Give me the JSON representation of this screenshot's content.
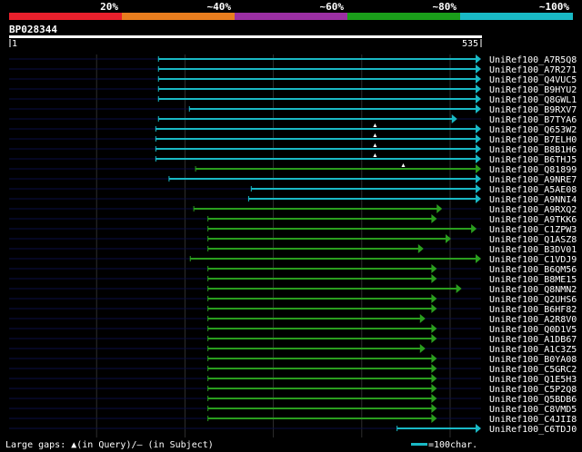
{
  "identity_legend": {
    "labels": [
      "20%",
      "~40%",
      "~60%",
      "~80%",
      "~100%"
    ],
    "colors": [
      "#e8202c",
      "#e87d1e",
      "#9b2fa3",
      "#1a9e1a",
      "#19b9c5"
    ]
  },
  "query": {
    "id": "BP028344",
    "start_label": "1",
    "end_label": "535",
    "length": 535
  },
  "colors": {
    "background": "#000000",
    "high_identity": "#19b9c5",
    "mid_identity": "#2a9e1e",
    "lane": "#0a0e44",
    "grid": "#2e2e2e",
    "text": "#ffffff"
  },
  "hits": [
    {
      "id": "UniRef100_A7R5Q8",
      "start": 170,
      "end": 535,
      "color": "cyan",
      "gap": null
    },
    {
      "id": "UniRef100_A7R271",
      "start": 170,
      "end": 535,
      "color": "cyan",
      "gap": null
    },
    {
      "id": "UniRef100_Q4VUC5",
      "start": 170,
      "end": 535,
      "color": "cyan",
      "gap": null
    },
    {
      "id": "UniRef100_B9HYU2",
      "start": 170,
      "end": 535,
      "color": "cyan",
      "gap": null
    },
    {
      "id": "UniRef100_Q8GWL1",
      "start": 170,
      "end": 535,
      "color": "cyan",
      "gap": null
    },
    {
      "id": "UniRef100_B9RXV7",
      "start": 205,
      "end": 535,
      "color": "cyan",
      "gap": null
    },
    {
      "id": "UniRef100_B7TYA6",
      "start": 170,
      "end": 508,
      "color": "cyan",
      "gap": null
    },
    {
      "id": "UniRef100_Q653W2",
      "start": 167,
      "end": 535,
      "color": "cyan",
      "gap": 415
    },
    {
      "id": "UniRef100_B7ELH0",
      "start": 167,
      "end": 535,
      "color": "cyan",
      "gap": 415
    },
    {
      "id": "UniRef100_B8B1H6",
      "start": 167,
      "end": 535,
      "color": "cyan",
      "gap": 415
    },
    {
      "id": "UniRef100_B6THJ5",
      "start": 167,
      "end": 535,
      "color": "cyan",
      "gap": 415
    },
    {
      "id": "UniRef100_Q81899",
      "start": 212,
      "end": 535,
      "color": "green",
      "gap": 447
    },
    {
      "id": "UniRef100_A9NRE7",
      "start": 182,
      "end": 535,
      "color": "cyan",
      "gap": null
    },
    {
      "id": "UniRef100_A5AE08",
      "start": 275,
      "end": 535,
      "color": "cyan",
      "gap": null
    },
    {
      "id": "UniRef100_A9NNI4",
      "start": 272,
      "end": 535,
      "color": "cyan",
      "gap": null
    },
    {
      "id": "UniRef100_A9RXQ2",
      "start": 210,
      "end": 491,
      "color": "green",
      "gap": null
    },
    {
      "id": "UniRef100_A9TKK6",
      "start": 226,
      "end": 485,
      "color": "green",
      "gap": null
    },
    {
      "id": "UniRef100_C1ZPW3",
      "start": 226,
      "end": 530,
      "color": "green",
      "gap": null
    },
    {
      "id": "UniRef100_Q1ASZ8",
      "start": 226,
      "end": 501,
      "color": "green",
      "gap": null
    },
    {
      "id": "UniRef100_B3DV01",
      "start": 226,
      "end": 470,
      "color": "green",
      "gap": null
    },
    {
      "id": "UniRef100_C1VDJ9",
      "start": 206,
      "end": 535,
      "color": "green",
      "gap": null
    },
    {
      "id": "UniRef100_B6QM56",
      "start": 226,
      "end": 485,
      "color": "green",
      "gap": null
    },
    {
      "id": "UniRef100_B8ME15",
      "start": 226,
      "end": 485,
      "color": "green",
      "gap": null
    },
    {
      "id": "UniRef100_Q8NMN2",
      "start": 226,
      "end": 513,
      "color": "green",
      "gap": null
    },
    {
      "id": "UniRef100_Q2UHS6",
      "start": 226,
      "end": 485,
      "color": "green",
      "gap": null
    },
    {
      "id": "UniRef100_B6HF82",
      "start": 226,
      "end": 485,
      "color": "green",
      "gap": null
    },
    {
      "id": "UniRef100_A2R8V0",
      "start": 226,
      "end": 472,
      "color": "green",
      "gap": null
    },
    {
      "id": "UniRef100_Q0D1V5",
      "start": 226,
      "end": 485,
      "color": "green",
      "gap": null
    },
    {
      "id": "UniRef100_A1DB67",
      "start": 226,
      "end": 485,
      "color": "green",
      "gap": null
    },
    {
      "id": "UniRef100_A1C3Z5",
      "start": 226,
      "end": 472,
      "color": "green",
      "gap": null
    },
    {
      "id": "UniRef100_B0YA08",
      "start": 226,
      "end": 485,
      "color": "green",
      "gap": null
    },
    {
      "id": "UniRef100_C5GRC2",
      "start": 226,
      "end": 485,
      "color": "green",
      "gap": null
    },
    {
      "id": "UniRef100_Q1E5H3",
      "start": 226,
      "end": 485,
      "color": "green",
      "gap": null
    },
    {
      "id": "UniRef100_C5P2Q8",
      "start": 226,
      "end": 485,
      "color": "green",
      "gap": null
    },
    {
      "id": "UniRef100_Q5BDB6",
      "start": 226,
      "end": 485,
      "color": "green",
      "gap": null
    },
    {
      "id": "UniRef100_C8VMD5",
      "start": 226,
      "end": 485,
      "color": "green",
      "gap": null
    },
    {
      "id": "UniRef100_C4JII8",
      "start": 226,
      "end": 485,
      "color": "green",
      "gap": null
    },
    {
      "id": "UniRef100_C6TDJ0",
      "start": 440,
      "end": 535,
      "color": "cyan",
      "gap": null
    }
  ],
  "footer": {
    "gaps_text": "Large gaps: ▲(in Query)/– (in Subject)",
    "scale_text": "=100char."
  }
}
